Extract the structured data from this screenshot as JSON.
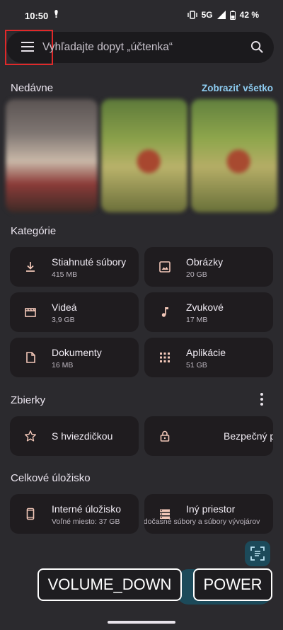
{
  "status_bar": {
    "time": "10:50",
    "network": "5G",
    "battery": "42 %"
  },
  "search": {
    "placeholder": "Vyhľadajte dopyt „účtenka“"
  },
  "recent": {
    "title": "Nedávne",
    "see_all": "Zobraziť všetko"
  },
  "categories": {
    "title": "Kategórie",
    "items": [
      {
        "label": "Stiahnuté súbory",
        "size": "415 MB",
        "icon": "download-icon"
      },
      {
        "label": "Obrázky",
        "size": "20 GB",
        "icon": "image-icon"
      },
      {
        "label": "Videá",
        "size": "3,9 GB",
        "icon": "video-icon"
      },
      {
        "label": "Zvukové",
        "size": "17 MB",
        "icon": "music-note-icon"
      },
      {
        "label": "Dokumenty",
        "size": "16 MB",
        "icon": "document-icon"
      },
      {
        "label": "Aplikácie",
        "size": "51 GB",
        "icon": "apps-grid-icon"
      }
    ]
  },
  "collections": {
    "title": "Zbierky",
    "items": [
      {
        "label": "S hviezdičkou",
        "icon": "star-icon"
      },
      {
        "label": "Bezpečný priečinok",
        "icon": "lock-icon"
      }
    ]
  },
  "storage": {
    "title": "Celkové úložisko",
    "items": [
      {
        "label": "Interné úložisko",
        "sub": "Voľné miesto: 37 GB",
        "icon": "phone-icon"
      },
      {
        "label": "Iný priestor",
        "sub": "Systém, dočasné súbory a súbory vývojárov",
        "icon": "storage-icon"
      }
    ]
  },
  "overlay": {
    "volume_down": "VOLUME_DOWN",
    "power": "POWER"
  }
}
